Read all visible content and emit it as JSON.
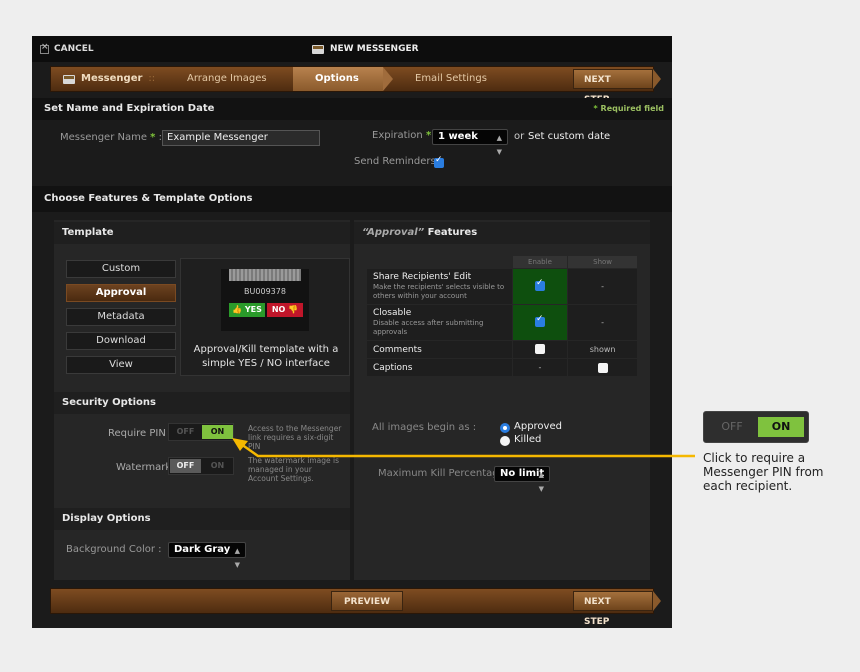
{
  "titlebar": {
    "cancel_label": "CANCEL",
    "title": "NEW MESSENGER"
  },
  "wizard": {
    "brand": "Messenger",
    "separator": "::",
    "steps": [
      "Arrange Images",
      "Options",
      "Email Settings"
    ],
    "active_step": "Options",
    "next_label": "NEXT STEP"
  },
  "section_name": {
    "title": "Set Name and Expiration Date",
    "required_note": "Required field",
    "required_marker": "*",
    "messenger_name_label": "Messenger Name",
    "messenger_name_value": "Example Messenger",
    "expiration_label": "Expiration",
    "expiration_value": "1 week",
    "custom_date_prefix": "or",
    "custom_date_link": "Set custom date",
    "reminders_label": "Send Reminders :",
    "reminders_checked": true
  },
  "section_features": {
    "title": "Choose Features & Template Options"
  },
  "template": {
    "title": "Template",
    "options": [
      "Custom",
      "Approval",
      "Metadata",
      "Download",
      "View"
    ],
    "selected": "Approval",
    "preview_id": "BU009378",
    "yes_label": "YES",
    "no_label": "NO",
    "description": "Approval/Kill template with a simple YES / NO interface"
  },
  "security": {
    "title": "Security Options",
    "require_pin_label": "Require PIN :",
    "require_pin_state": "ON",
    "require_pin_note": "Access to the Messenger link requires a six-digit PIN",
    "watermark_label": "Watermark :",
    "watermark_state": "OFF",
    "watermark_note": "The watermark image is managed in your Account Settings.",
    "off_label": "OFF",
    "on_label": "ON"
  },
  "display": {
    "title": "Display Options",
    "bg_color_label": "Background Color :",
    "bg_color_value": "Dark Gray"
  },
  "features": {
    "title_quoted": "“Approval”",
    "title_rest": "Features",
    "col_enable": "Enable",
    "col_show": "Show",
    "rows": [
      {
        "name": "Share Recipients' Edit",
        "desc": "Make the recipients' selects visible to others within your account",
        "enable": "checked",
        "show": "-"
      },
      {
        "name": "Closable",
        "desc": "Disable access after submitting approvals",
        "enable": "checked",
        "show": "-"
      },
      {
        "name": "Comments",
        "desc": "",
        "enable": "unchecked",
        "show": "shown"
      },
      {
        "name": "Captions",
        "desc": "",
        "enable": "-",
        "show": "unchecked"
      }
    ],
    "begin_as_label": "All images begin as :",
    "begin_as_options": [
      "Approved",
      "Killed"
    ],
    "begin_as_selected": "Approved",
    "max_kill_label": "Maximum Kill Percentage :",
    "max_kill_value": "No limit"
  },
  "footer": {
    "preview_label": "PREVIEW",
    "next_label": "NEXT STEP"
  },
  "callout": {
    "off_label": "OFF",
    "on_label": "ON",
    "text": "Click to require a Messenger PIN from each recipient.",
    "arrow_color": "#f5b800"
  }
}
